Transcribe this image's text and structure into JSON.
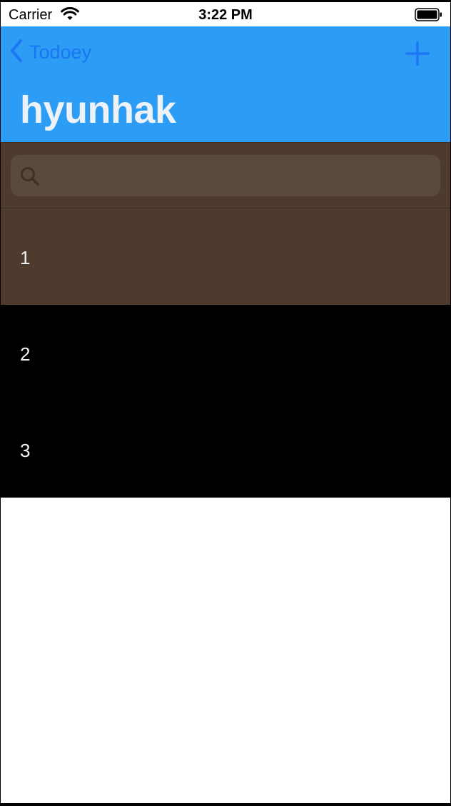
{
  "status_bar": {
    "carrier": "Carrier",
    "time": "3:22 PM"
  },
  "nav": {
    "back_label": "Todoey",
    "title": "hyunhak"
  },
  "search": {
    "placeholder": "",
    "value": ""
  },
  "items": [
    {
      "label": "1",
      "bg": "#4f3b2d"
    },
    {
      "label": "2",
      "bg": "#000000"
    },
    {
      "label": "3",
      "bg": "#000000"
    }
  ],
  "colors": {
    "nav_bar": "#2c9cf4",
    "tint": "#1a76f2",
    "search_bar_bg": "#4f3b2d"
  }
}
